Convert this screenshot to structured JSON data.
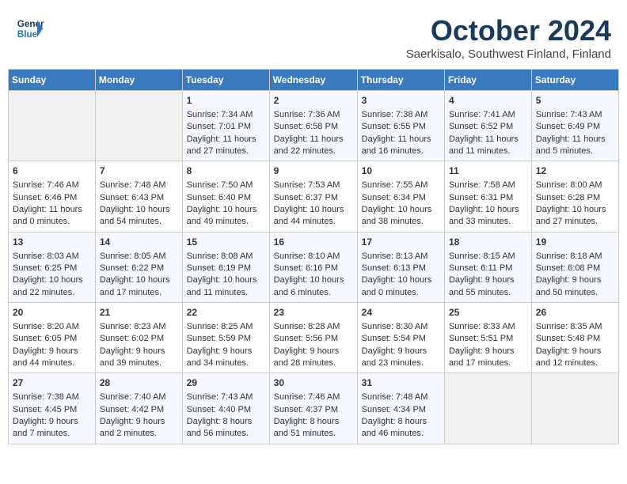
{
  "header": {
    "logo_line1": "General",
    "logo_line2": "Blue",
    "title": "October 2024",
    "subtitle": "Saerkisalo, Southwest Finland, Finland"
  },
  "weekdays": [
    "Sunday",
    "Monday",
    "Tuesday",
    "Wednesday",
    "Thursday",
    "Friday",
    "Saturday"
  ],
  "weeks": [
    [
      {
        "day": "",
        "sunrise": "",
        "sunset": "",
        "daylight": ""
      },
      {
        "day": "",
        "sunrise": "",
        "sunset": "",
        "daylight": ""
      },
      {
        "day": "1",
        "sunrise": "Sunrise: 7:34 AM",
        "sunset": "Sunset: 7:01 PM",
        "daylight": "Daylight: 11 hours and 27 minutes."
      },
      {
        "day": "2",
        "sunrise": "Sunrise: 7:36 AM",
        "sunset": "Sunset: 6:58 PM",
        "daylight": "Daylight: 11 hours and 22 minutes."
      },
      {
        "day": "3",
        "sunrise": "Sunrise: 7:38 AM",
        "sunset": "Sunset: 6:55 PM",
        "daylight": "Daylight: 11 hours and 16 minutes."
      },
      {
        "day": "4",
        "sunrise": "Sunrise: 7:41 AM",
        "sunset": "Sunset: 6:52 PM",
        "daylight": "Daylight: 11 hours and 11 minutes."
      },
      {
        "day": "5",
        "sunrise": "Sunrise: 7:43 AM",
        "sunset": "Sunset: 6:49 PM",
        "daylight": "Daylight: 11 hours and 5 minutes."
      }
    ],
    [
      {
        "day": "6",
        "sunrise": "Sunrise: 7:46 AM",
        "sunset": "Sunset: 6:46 PM",
        "daylight": "Daylight: 11 hours and 0 minutes."
      },
      {
        "day": "7",
        "sunrise": "Sunrise: 7:48 AM",
        "sunset": "Sunset: 6:43 PM",
        "daylight": "Daylight: 10 hours and 54 minutes."
      },
      {
        "day": "8",
        "sunrise": "Sunrise: 7:50 AM",
        "sunset": "Sunset: 6:40 PM",
        "daylight": "Daylight: 10 hours and 49 minutes."
      },
      {
        "day": "9",
        "sunrise": "Sunrise: 7:53 AM",
        "sunset": "Sunset: 6:37 PM",
        "daylight": "Daylight: 10 hours and 44 minutes."
      },
      {
        "day": "10",
        "sunrise": "Sunrise: 7:55 AM",
        "sunset": "Sunset: 6:34 PM",
        "daylight": "Daylight: 10 hours and 38 minutes."
      },
      {
        "day": "11",
        "sunrise": "Sunrise: 7:58 AM",
        "sunset": "Sunset: 6:31 PM",
        "daylight": "Daylight: 10 hours and 33 minutes."
      },
      {
        "day": "12",
        "sunrise": "Sunrise: 8:00 AM",
        "sunset": "Sunset: 6:28 PM",
        "daylight": "Daylight: 10 hours and 27 minutes."
      }
    ],
    [
      {
        "day": "13",
        "sunrise": "Sunrise: 8:03 AM",
        "sunset": "Sunset: 6:25 PM",
        "daylight": "Daylight: 10 hours and 22 minutes."
      },
      {
        "day": "14",
        "sunrise": "Sunrise: 8:05 AM",
        "sunset": "Sunset: 6:22 PM",
        "daylight": "Daylight: 10 hours and 17 minutes."
      },
      {
        "day": "15",
        "sunrise": "Sunrise: 8:08 AM",
        "sunset": "Sunset: 6:19 PM",
        "daylight": "Daylight: 10 hours and 11 minutes."
      },
      {
        "day": "16",
        "sunrise": "Sunrise: 8:10 AM",
        "sunset": "Sunset: 6:16 PM",
        "daylight": "Daylight: 10 hours and 6 minutes."
      },
      {
        "day": "17",
        "sunrise": "Sunrise: 8:13 AM",
        "sunset": "Sunset: 6:13 PM",
        "daylight": "Daylight: 10 hours and 0 minutes."
      },
      {
        "day": "18",
        "sunrise": "Sunrise: 8:15 AM",
        "sunset": "Sunset: 6:11 PM",
        "daylight": "Daylight: 9 hours and 55 minutes."
      },
      {
        "day": "19",
        "sunrise": "Sunrise: 8:18 AM",
        "sunset": "Sunset: 6:08 PM",
        "daylight": "Daylight: 9 hours and 50 minutes."
      }
    ],
    [
      {
        "day": "20",
        "sunrise": "Sunrise: 8:20 AM",
        "sunset": "Sunset: 6:05 PM",
        "daylight": "Daylight: 9 hours and 44 minutes."
      },
      {
        "day": "21",
        "sunrise": "Sunrise: 8:23 AM",
        "sunset": "Sunset: 6:02 PM",
        "daylight": "Daylight: 9 hours and 39 minutes."
      },
      {
        "day": "22",
        "sunrise": "Sunrise: 8:25 AM",
        "sunset": "Sunset: 5:59 PM",
        "daylight": "Daylight: 9 hours and 34 minutes."
      },
      {
        "day": "23",
        "sunrise": "Sunrise: 8:28 AM",
        "sunset": "Sunset: 5:56 PM",
        "daylight": "Daylight: 9 hours and 28 minutes."
      },
      {
        "day": "24",
        "sunrise": "Sunrise: 8:30 AM",
        "sunset": "Sunset: 5:54 PM",
        "daylight": "Daylight: 9 hours and 23 minutes."
      },
      {
        "day": "25",
        "sunrise": "Sunrise: 8:33 AM",
        "sunset": "Sunset: 5:51 PM",
        "daylight": "Daylight: 9 hours and 17 minutes."
      },
      {
        "day": "26",
        "sunrise": "Sunrise: 8:35 AM",
        "sunset": "Sunset: 5:48 PM",
        "daylight": "Daylight: 9 hours and 12 minutes."
      }
    ],
    [
      {
        "day": "27",
        "sunrise": "Sunrise: 7:38 AM",
        "sunset": "Sunset: 4:45 PM",
        "daylight": "Daylight: 9 hours and 7 minutes."
      },
      {
        "day": "28",
        "sunrise": "Sunrise: 7:40 AM",
        "sunset": "Sunset: 4:42 PM",
        "daylight": "Daylight: 9 hours and 2 minutes."
      },
      {
        "day": "29",
        "sunrise": "Sunrise: 7:43 AM",
        "sunset": "Sunset: 4:40 PM",
        "daylight": "Daylight: 8 hours and 56 minutes."
      },
      {
        "day": "30",
        "sunrise": "Sunrise: 7:46 AM",
        "sunset": "Sunset: 4:37 PM",
        "daylight": "Daylight: 8 hours and 51 minutes."
      },
      {
        "day": "31",
        "sunrise": "Sunrise: 7:48 AM",
        "sunset": "Sunset: 4:34 PM",
        "daylight": "Daylight: 8 hours and 46 minutes."
      },
      {
        "day": "",
        "sunrise": "",
        "sunset": "",
        "daylight": ""
      },
      {
        "day": "",
        "sunrise": "",
        "sunset": "",
        "daylight": ""
      }
    ]
  ]
}
